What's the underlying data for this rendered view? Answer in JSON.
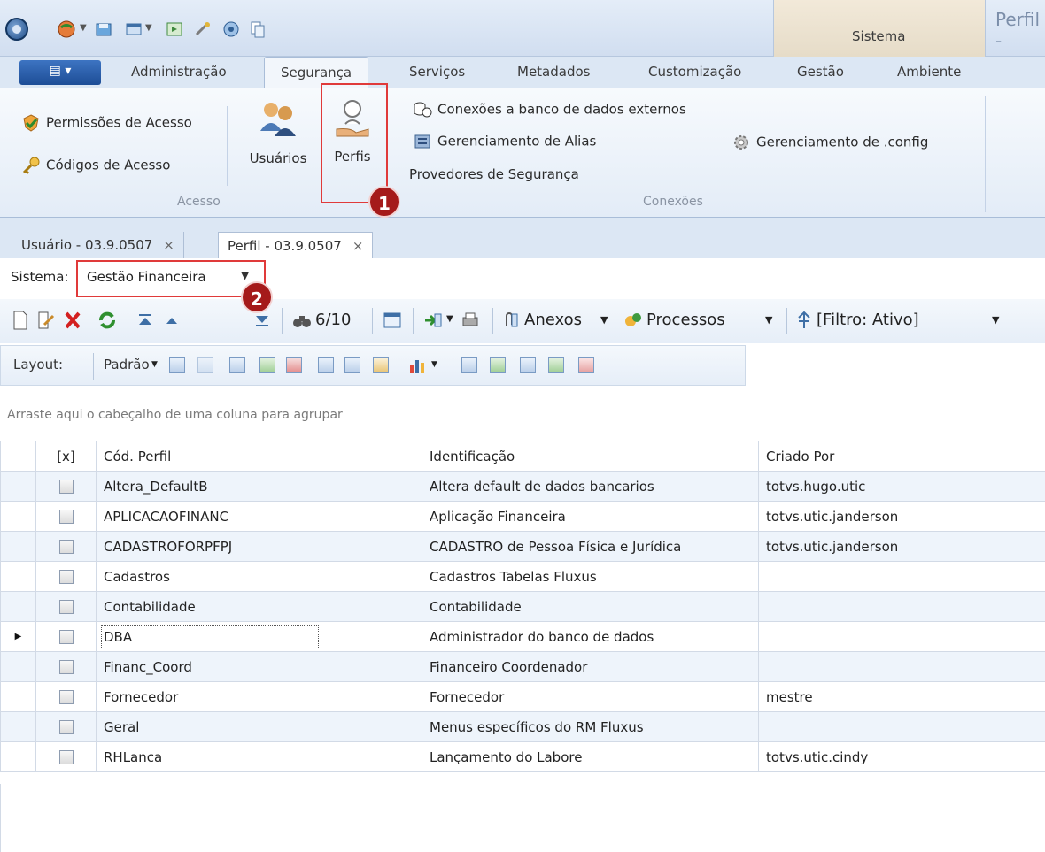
{
  "title_bar": {
    "system_tab": "Sistema",
    "window_title": "Perfil -"
  },
  "ribbon_tabs": [
    "Administração",
    "Segurança",
    "Serviços",
    "Metadados",
    "Customização",
    "Gestão",
    "Ambiente"
  ],
  "ribbon": {
    "acesso": {
      "permissoes": "Permissões de Acesso",
      "codigos": "Códigos de Acesso",
      "usuarios": "Usuários",
      "perfis": "Perfis",
      "group_label": "Acesso"
    },
    "conexoes": {
      "banco_externo": "Conexões a banco de dados externos",
      "alias": "Gerenciamento de Alias",
      "provedores": "Provedores de Segurança",
      "config": "Gerenciamento de .config",
      "group_label": "Conexões"
    }
  },
  "doc_tabs": [
    {
      "label": "Usuário - 03.9.0507",
      "close": "×"
    },
    {
      "label": "Perfil - 03.9.0507",
      "close": "×"
    }
  ],
  "sistema": {
    "label": "Sistema:",
    "value": "Gestão Financeira"
  },
  "toolbar": {
    "record_counter": "6/10",
    "anexos": "Anexos",
    "processos": "Processos",
    "filtro": "[Filtro: Ativo]"
  },
  "layout_bar": {
    "label": "Layout:",
    "padrao": "Padrão"
  },
  "grid": {
    "group_hint": "Arraste aqui o cabeçalho de uma coluna para agrupar",
    "columns": [
      "[x]",
      "Cód. Perfil",
      "Identificação",
      "Criado Por"
    ],
    "rows": [
      {
        "code": "Altera_DefaultB",
        "ident": "Altera default de dados bancarios",
        "by": "totvs.hugo.utic"
      },
      {
        "code": "APLICACAOFINANC",
        "ident": "Aplicação Financeira",
        "by": "totvs.utic.janderson"
      },
      {
        "code": "CADASTROFORPFPJ",
        "ident": "CADASTRO de Pessoa Física e Jurídica",
        "by": "totvs.utic.janderson"
      },
      {
        "code": "Cadastros",
        "ident": "Cadastros Tabelas Fluxus",
        "by": ""
      },
      {
        "code": "Contabilidade",
        "ident": "Contabilidade",
        "by": ""
      },
      {
        "code": "DBA",
        "ident": "Administrador do banco de dados",
        "by": ""
      },
      {
        "code": "Financ_Coord",
        "ident": "Financeiro Coordenador",
        "by": ""
      },
      {
        "code": "Fornecedor",
        "ident": "Fornecedor",
        "by": "mestre"
      },
      {
        "code": "Geral",
        "ident": "Menus específicos do RM Fluxus",
        "by": ""
      },
      {
        "code": "RHLanca",
        "ident": "Lançamento do Labore",
        "by": "totvs.utic.cindy"
      }
    ]
  },
  "callouts": {
    "one": "1",
    "two": "2"
  },
  "colors": {
    "callout_border": "#e03a3a",
    "badge_fill": "#a51a1a",
    "row_alt": "#eef4fb"
  }
}
